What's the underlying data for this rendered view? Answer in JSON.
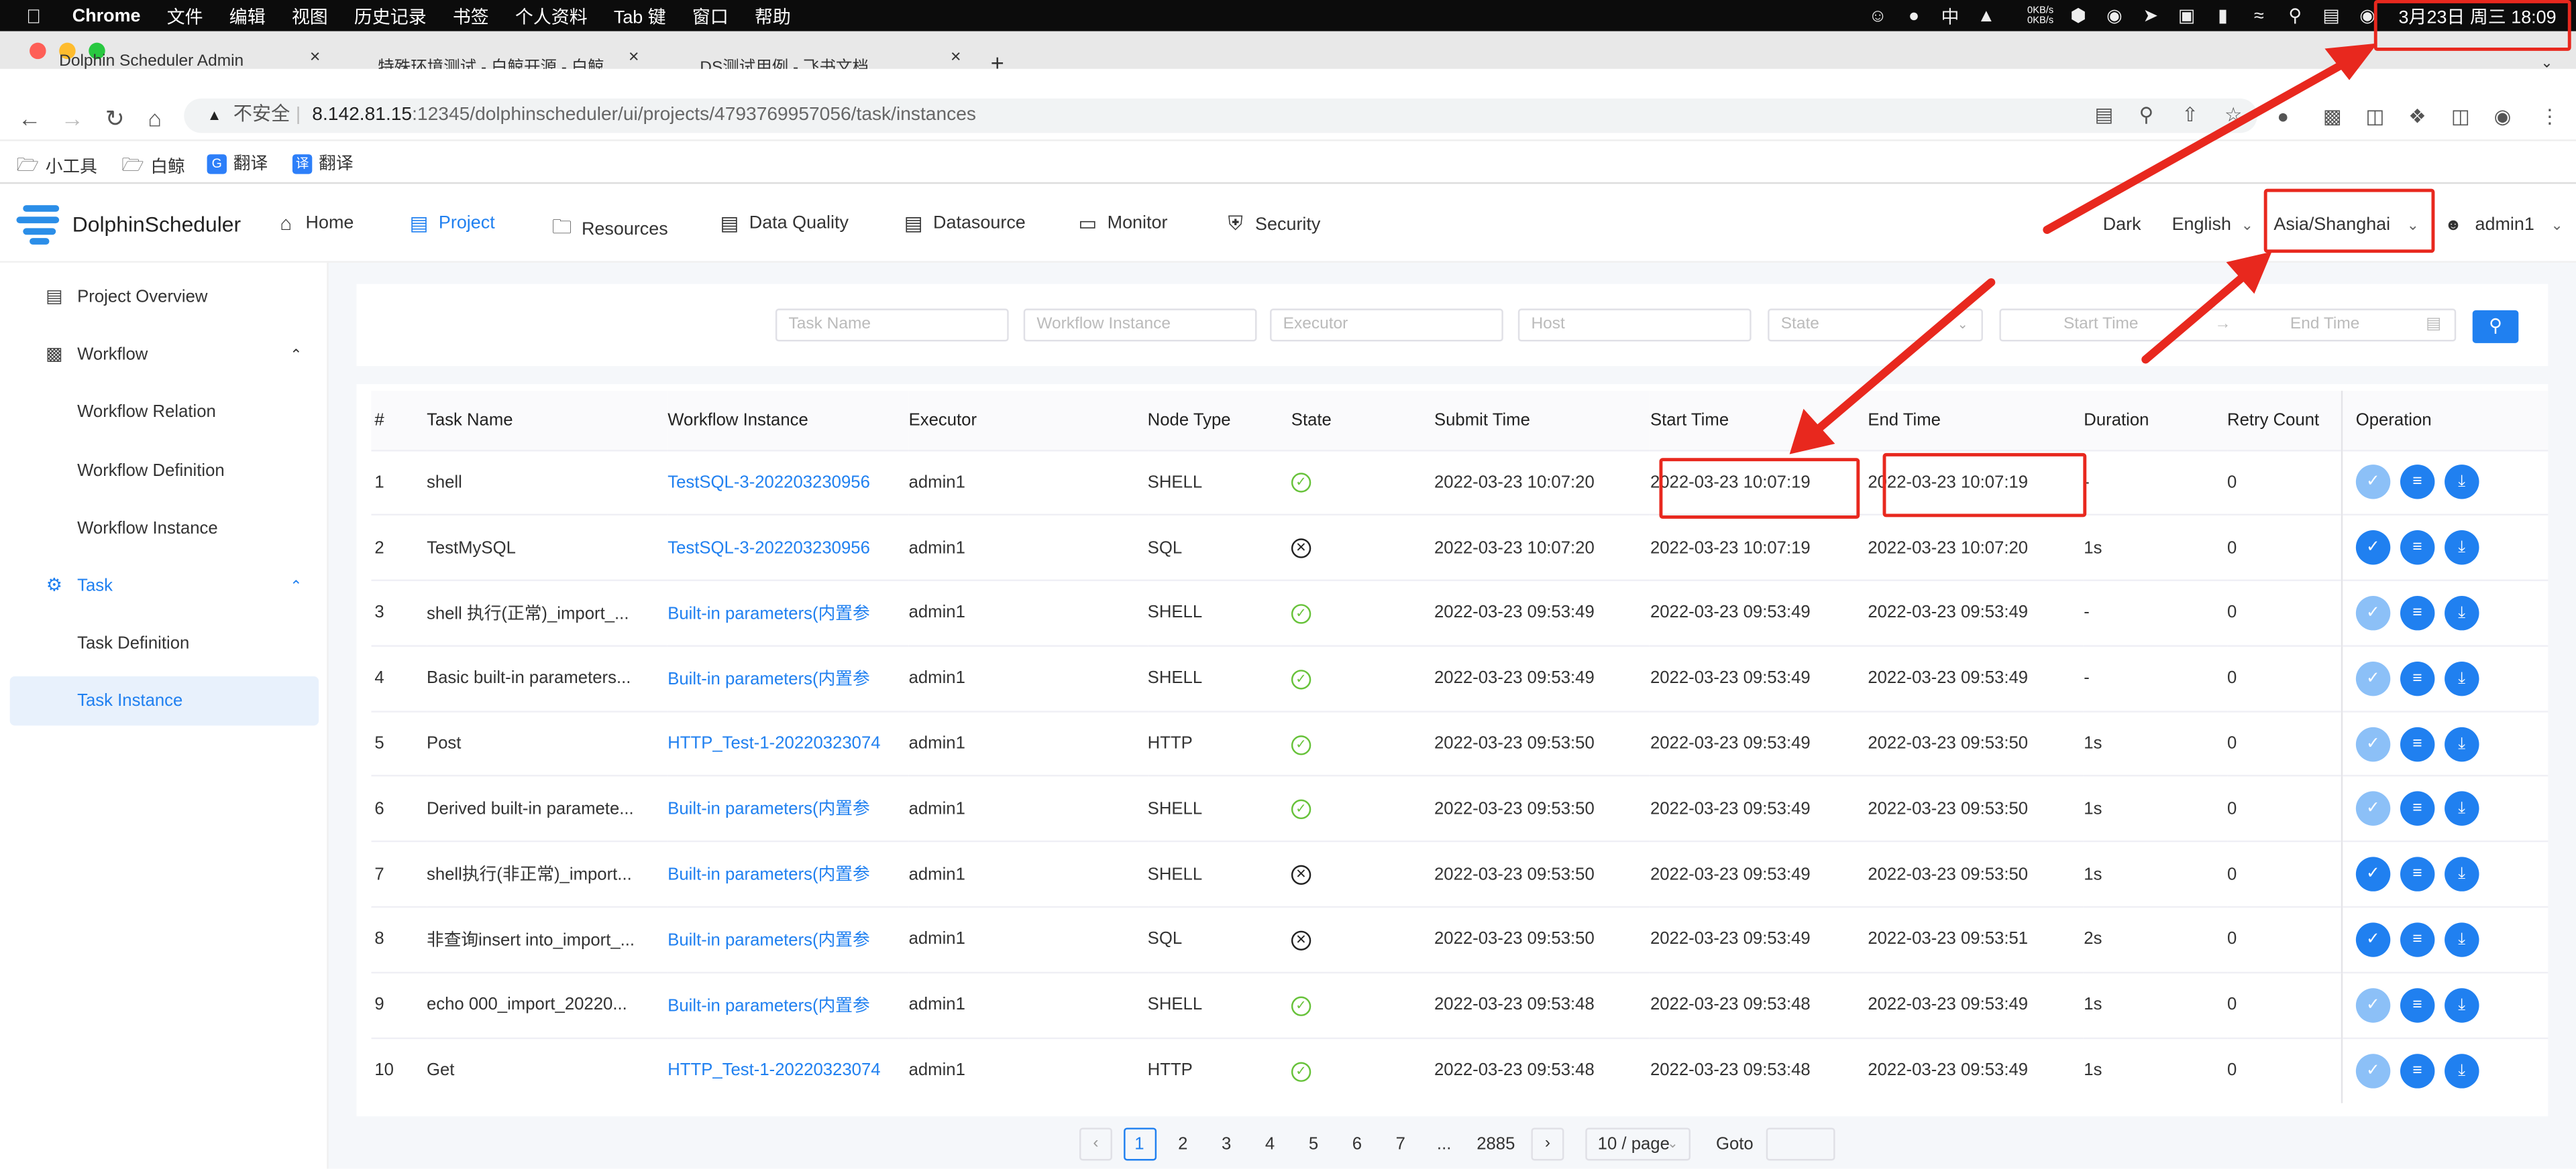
{
  "menubar": {
    "app": "Chrome",
    "items": [
      "文件",
      "编辑",
      "视图",
      "历史记录",
      "书签",
      "个人资料",
      "Tab 键",
      "窗口",
      "帮助"
    ],
    "ime": "中",
    "net_up": "0KB/s",
    "net_down": "0KB/s",
    "clock": "3月23日 周三  18:09"
  },
  "browser": {
    "tabs": [
      {
        "title": "Dolphin Scheduler Admin"
      },
      {
        "title": "特殊环境测试 - 白鲸开源 - 白鲸..."
      },
      {
        "title": "DS测试用例 - 飞书文档"
      }
    ],
    "security_label": "不安全",
    "url_host": "8.142.81.15",
    "url_rest": ":12345/dolphinscheduler/ui/projects/4793769957056/task/instances",
    "bookmarks": [
      "小工具",
      "白鲸",
      "翻译",
      "翻译"
    ]
  },
  "header": {
    "logo": "DolphinScheduler",
    "nav": [
      "Home",
      "Project",
      "Resources",
      "Data Quality",
      "Datasource",
      "Monitor",
      "Security"
    ],
    "active_nav": "Project",
    "theme": "Dark",
    "language": "English",
    "timezone": "Asia/Shanghai",
    "user": "admin1"
  },
  "sidebar": {
    "items": [
      {
        "label": "Project Overview"
      },
      {
        "label": "Workflow"
      },
      {
        "label": "Workflow Relation"
      },
      {
        "label": "Workflow Definition"
      },
      {
        "label": "Workflow Instance"
      },
      {
        "label": "Task"
      },
      {
        "label": "Task Definition"
      },
      {
        "label": "Task Instance"
      }
    ]
  },
  "filters": {
    "task_name": "Task Name",
    "workflow_instance": "Workflow Instance",
    "executor": "Executor",
    "host": "Host",
    "state": "State",
    "start_time": "Start Time",
    "end_time": "End Time",
    "range_sep": "→"
  },
  "table": {
    "columns": [
      "#",
      "Task Name",
      "Workflow Instance",
      "Executor",
      "Node Type",
      "State",
      "Submit Time",
      "Start Time",
      "End Time",
      "Duration",
      "Retry Count",
      "Operation"
    ],
    "rows": [
      {
        "no": "1",
        "task": "shell",
        "wf": "TestSQL-3-202203230956",
        "executor": "admin1",
        "type": "SHELL",
        "state": "success",
        "submit": "2022-03-23 10:07:20",
        "start": "2022-03-23 10:07:19",
        "end": "2022-03-23 10:07:19",
        "duration": "-",
        "retry": "0"
      },
      {
        "no": "2",
        "task": "TestMySQL",
        "wf": "TestSQL-3-202203230956",
        "executor": "admin1",
        "type": "SQL",
        "state": "failure",
        "submit": "2022-03-23 10:07:20",
        "start": "2022-03-23 10:07:19",
        "end": "2022-03-23 10:07:20",
        "duration": "1s",
        "retry": "0"
      },
      {
        "no": "3",
        "task": "shell 执行(正常)_import_...",
        "wf": "Built-in parameters(内置参",
        "executor": "admin1",
        "type": "SHELL",
        "state": "success",
        "submit": "2022-03-23 09:53:49",
        "start": "2022-03-23 09:53:49",
        "end": "2022-03-23 09:53:49",
        "duration": "-",
        "retry": "0"
      },
      {
        "no": "4",
        "task": "Basic built-in parameters...",
        "wf": "Built-in parameters(内置参",
        "executor": "admin1",
        "type": "SHELL",
        "state": "success",
        "submit": "2022-03-23 09:53:49",
        "start": "2022-03-23 09:53:49",
        "end": "2022-03-23 09:53:49",
        "duration": "-",
        "retry": "0"
      },
      {
        "no": "5",
        "task": "Post",
        "wf": "HTTP_Test-1-20220323074",
        "executor": "admin1",
        "type": "HTTP",
        "state": "success",
        "submit": "2022-03-23 09:53:50",
        "start": "2022-03-23 09:53:49",
        "end": "2022-03-23 09:53:50",
        "duration": "1s",
        "retry": "0"
      },
      {
        "no": "6",
        "task": "Derived built-in paramete...",
        "wf": "Built-in parameters(内置参",
        "executor": "admin1",
        "type": "SHELL",
        "state": "success",
        "submit": "2022-03-23 09:53:50",
        "start": "2022-03-23 09:53:49",
        "end": "2022-03-23 09:53:50",
        "duration": "1s",
        "retry": "0"
      },
      {
        "no": "7",
        "task": "shell执行(非正常)_import...",
        "wf": "Built-in parameters(内置参",
        "executor": "admin1",
        "type": "SHELL",
        "state": "failure",
        "submit": "2022-03-23 09:53:50",
        "start": "2022-03-23 09:53:49",
        "end": "2022-03-23 09:53:50",
        "duration": "1s",
        "retry": "0"
      },
      {
        "no": "8",
        "task": "非查询insert into_import_...",
        "wf": "Built-in parameters(内置参",
        "executor": "admin1",
        "type": "SQL",
        "state": "failure",
        "submit": "2022-03-23 09:53:50",
        "start": "2022-03-23 09:53:49",
        "end": "2022-03-23 09:53:51",
        "duration": "2s",
        "retry": "0"
      },
      {
        "no": "9",
        "task": "echo 000_import_20220...",
        "wf": "Built-in parameters(内置参",
        "executor": "admin1",
        "type": "SHELL",
        "state": "success",
        "submit": "2022-03-23 09:53:48",
        "start": "2022-03-23 09:53:48",
        "end": "2022-03-23 09:53:49",
        "duration": "1s",
        "retry": "0"
      },
      {
        "no": "10",
        "task": "Get",
        "wf": "HTTP_Test-1-20220323074",
        "executor": "admin1",
        "type": "HTTP",
        "state": "success",
        "submit": "2022-03-23 09:53:48",
        "start": "2022-03-23 09:53:48",
        "end": "2022-03-23 09:53:49",
        "duration": "1s",
        "retry": "0"
      }
    ]
  },
  "pagination": {
    "pages": [
      "1",
      "2",
      "3",
      "4",
      "5",
      "6",
      "7",
      "...",
      "2885"
    ],
    "current": "1",
    "page_size": "10 / page",
    "goto_label": "Goto"
  },
  "colors": {
    "accent": "#2080f0",
    "success": "#67c23a",
    "annotation": "#e8281e"
  }
}
